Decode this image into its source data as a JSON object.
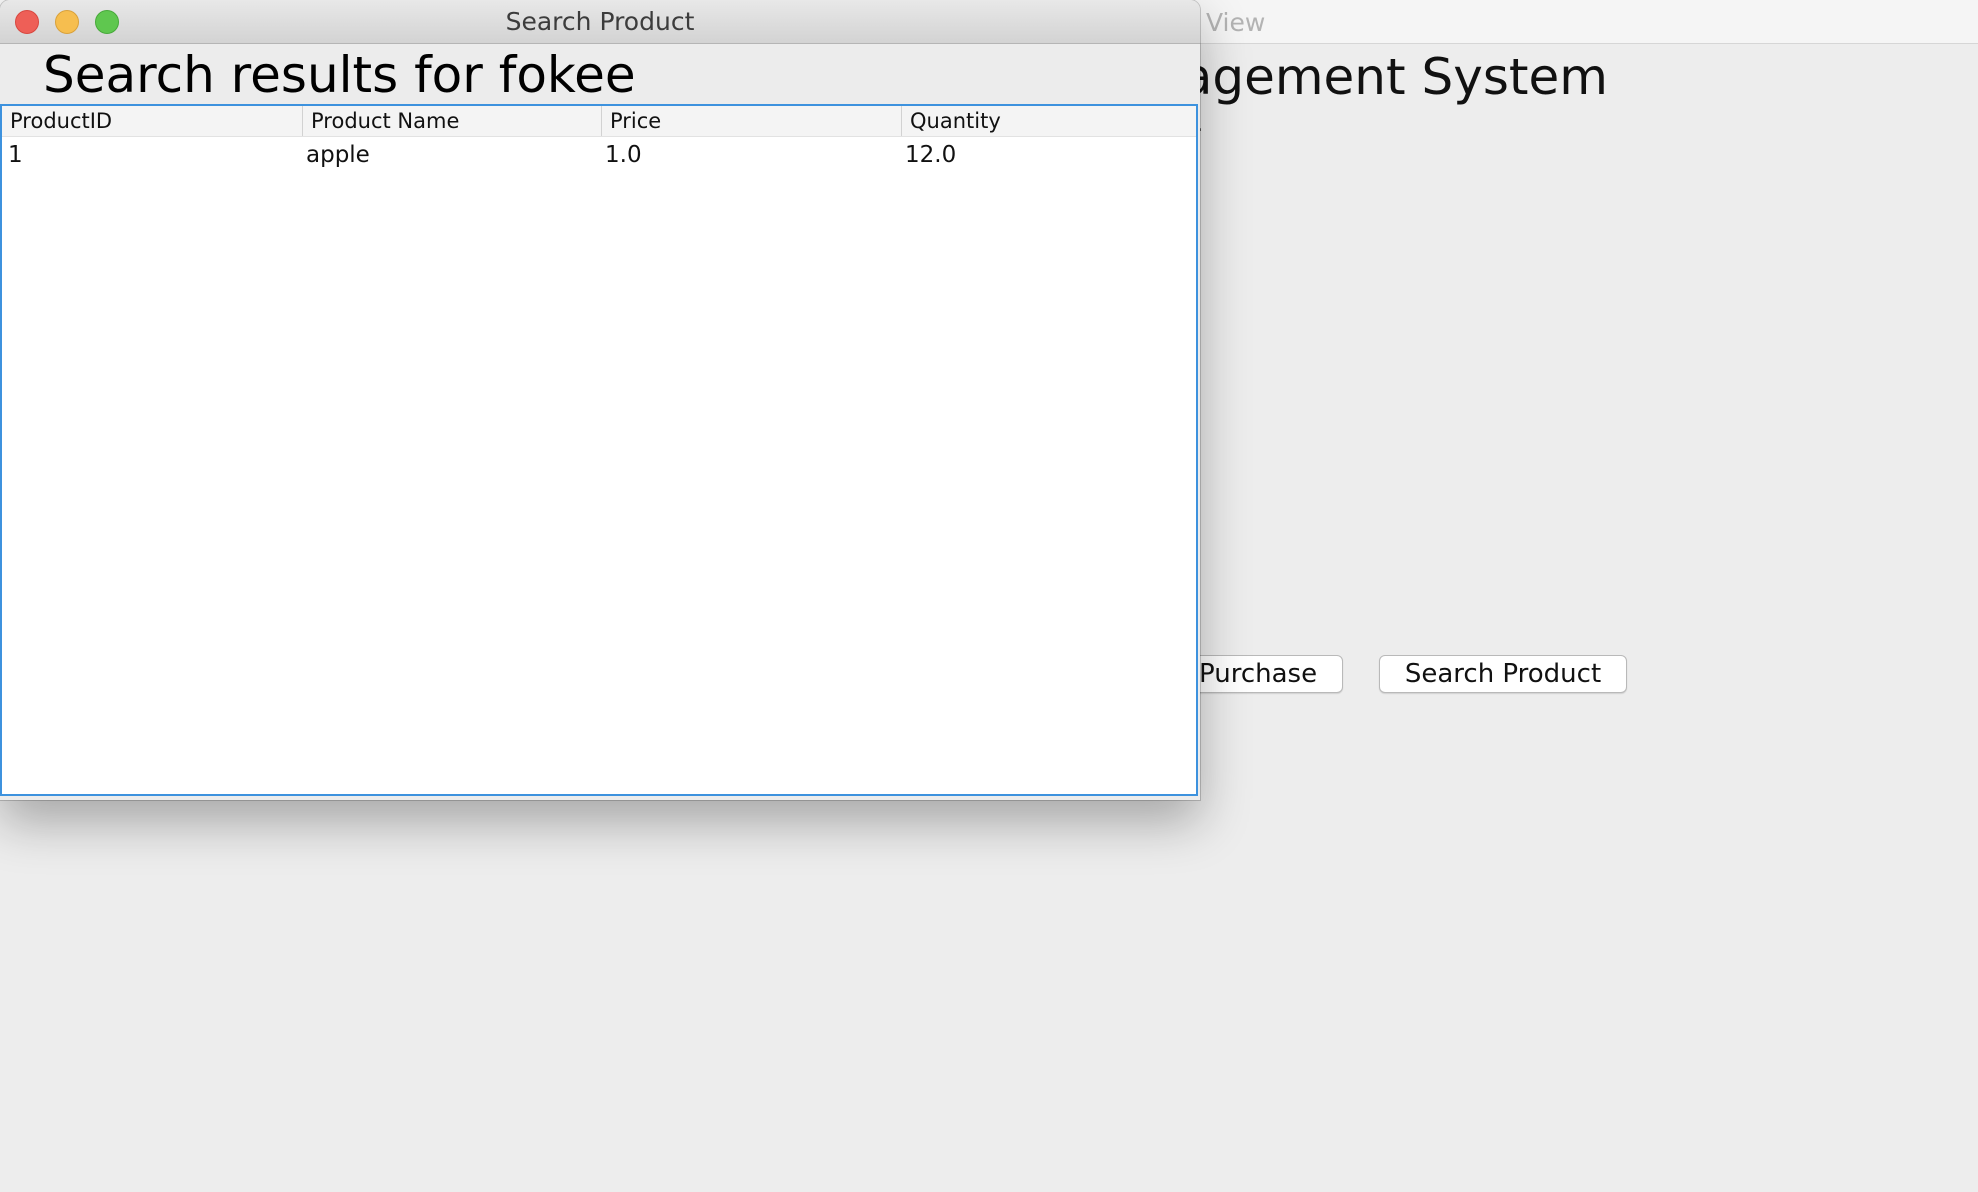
{
  "background_window": {
    "title": "View",
    "heading": "nagement System",
    "small_text": ".",
    "buttons": {
      "purchase": "Purchase",
      "search_product": "Search Product"
    }
  },
  "dialog": {
    "title": "Search Product",
    "heading": "Search results for fokee",
    "table": {
      "columns": [
        "ProductID",
        "Product Name",
        "Price",
        "Quantity"
      ],
      "rows": [
        [
          "1",
          "apple",
          "1.0",
          "12.0"
        ]
      ]
    }
  },
  "colors": {
    "close": "#ee5f57",
    "minimize": "#f6be4f",
    "maximize": "#5fc74f",
    "table_focus_border": "#3d92de"
  }
}
